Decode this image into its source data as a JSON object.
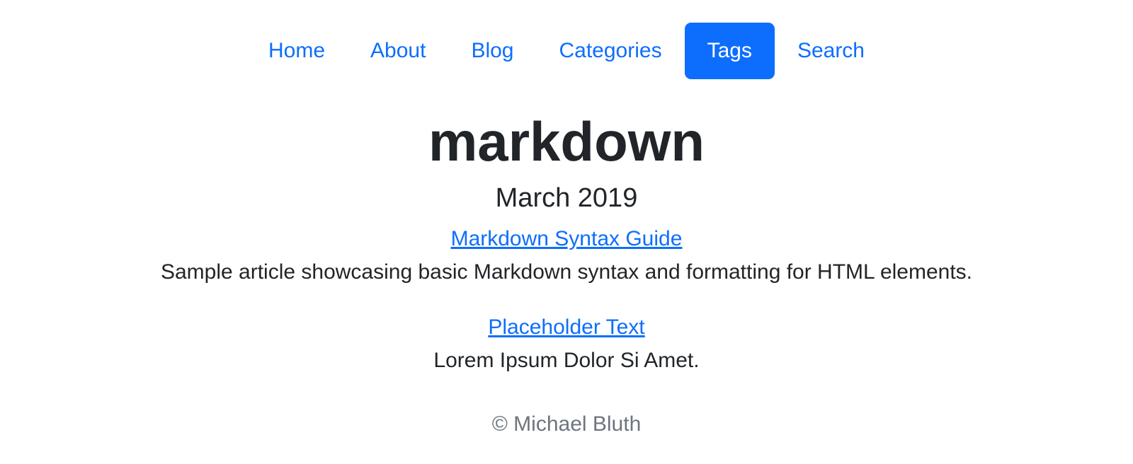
{
  "nav": {
    "items": [
      {
        "label": "Home",
        "active": false
      },
      {
        "label": "About",
        "active": false
      },
      {
        "label": "Blog",
        "active": false
      },
      {
        "label": "Categories",
        "active": false
      },
      {
        "label": "Tags",
        "active": true
      },
      {
        "label": "Search",
        "active": false
      }
    ]
  },
  "page": {
    "title": "markdown"
  },
  "archive": {
    "month": "March 2019",
    "posts": [
      {
        "title": "Markdown Syntax Guide",
        "summary": "Sample article showcasing basic Markdown syntax and formatting for HTML elements."
      },
      {
        "title": "Placeholder Text",
        "summary": "Lorem Ipsum Dolor Si Amet."
      }
    ]
  },
  "footer": {
    "text": "© Michael Bluth"
  },
  "colors": {
    "link": "#0d6efd",
    "active_bg": "#0d6efd",
    "text": "#212529",
    "muted": "#6c757d"
  }
}
